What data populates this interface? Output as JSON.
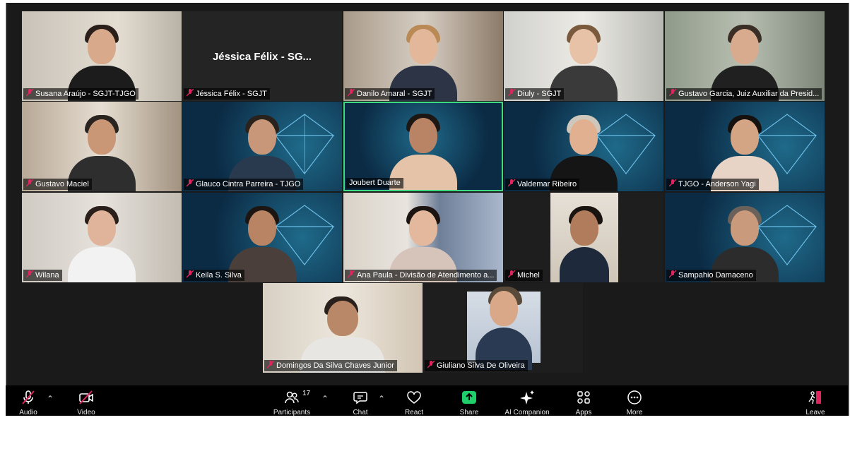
{
  "tiles": [
    {
      "name": "Susana Araújo - SGJT-TJGO"
    },
    {
      "name": "Jéssica Félix - SGJT",
      "display": "Jéssica Félix - SG..."
    },
    {
      "name": "Danilo Amaral - SGJT"
    },
    {
      "name": "Diuly - SGJT"
    },
    {
      "name": "Gustavo Garcia, Juiz Auxiliar da Presid..."
    },
    {
      "name": "Gustavo Maciel"
    },
    {
      "name": "Glauco Cintra Parreira - TJGO"
    },
    {
      "name": "Joubert Duarte"
    },
    {
      "name": "Valdemar Ribeiro"
    },
    {
      "name": "TJGO - Anderson Yagi"
    },
    {
      "name": "Wilana"
    },
    {
      "name": "Keila S. Silva"
    },
    {
      "name": "Ana Paula - Divisão de Atendimento a..."
    },
    {
      "name": "Michel"
    },
    {
      "name": "Sampahio Damaceno"
    },
    {
      "name": "Domingos Da Silva Chaves Junior"
    },
    {
      "name": "Giuliano Silva De Oliveira"
    }
  ],
  "toolbar": {
    "audio": "Audio",
    "video": "Video",
    "participants": "Participants",
    "participants_count": "17",
    "chat": "Chat",
    "react": "React",
    "share": "Share",
    "ai_companion": "AI Companion",
    "apps": "Apps",
    "more": "More",
    "leave": "Leave"
  },
  "colors": {
    "active_speaker": "#3ddc84",
    "muted": "#e0245e",
    "share": "#1fcf6b",
    "leave": "#e0245e"
  }
}
